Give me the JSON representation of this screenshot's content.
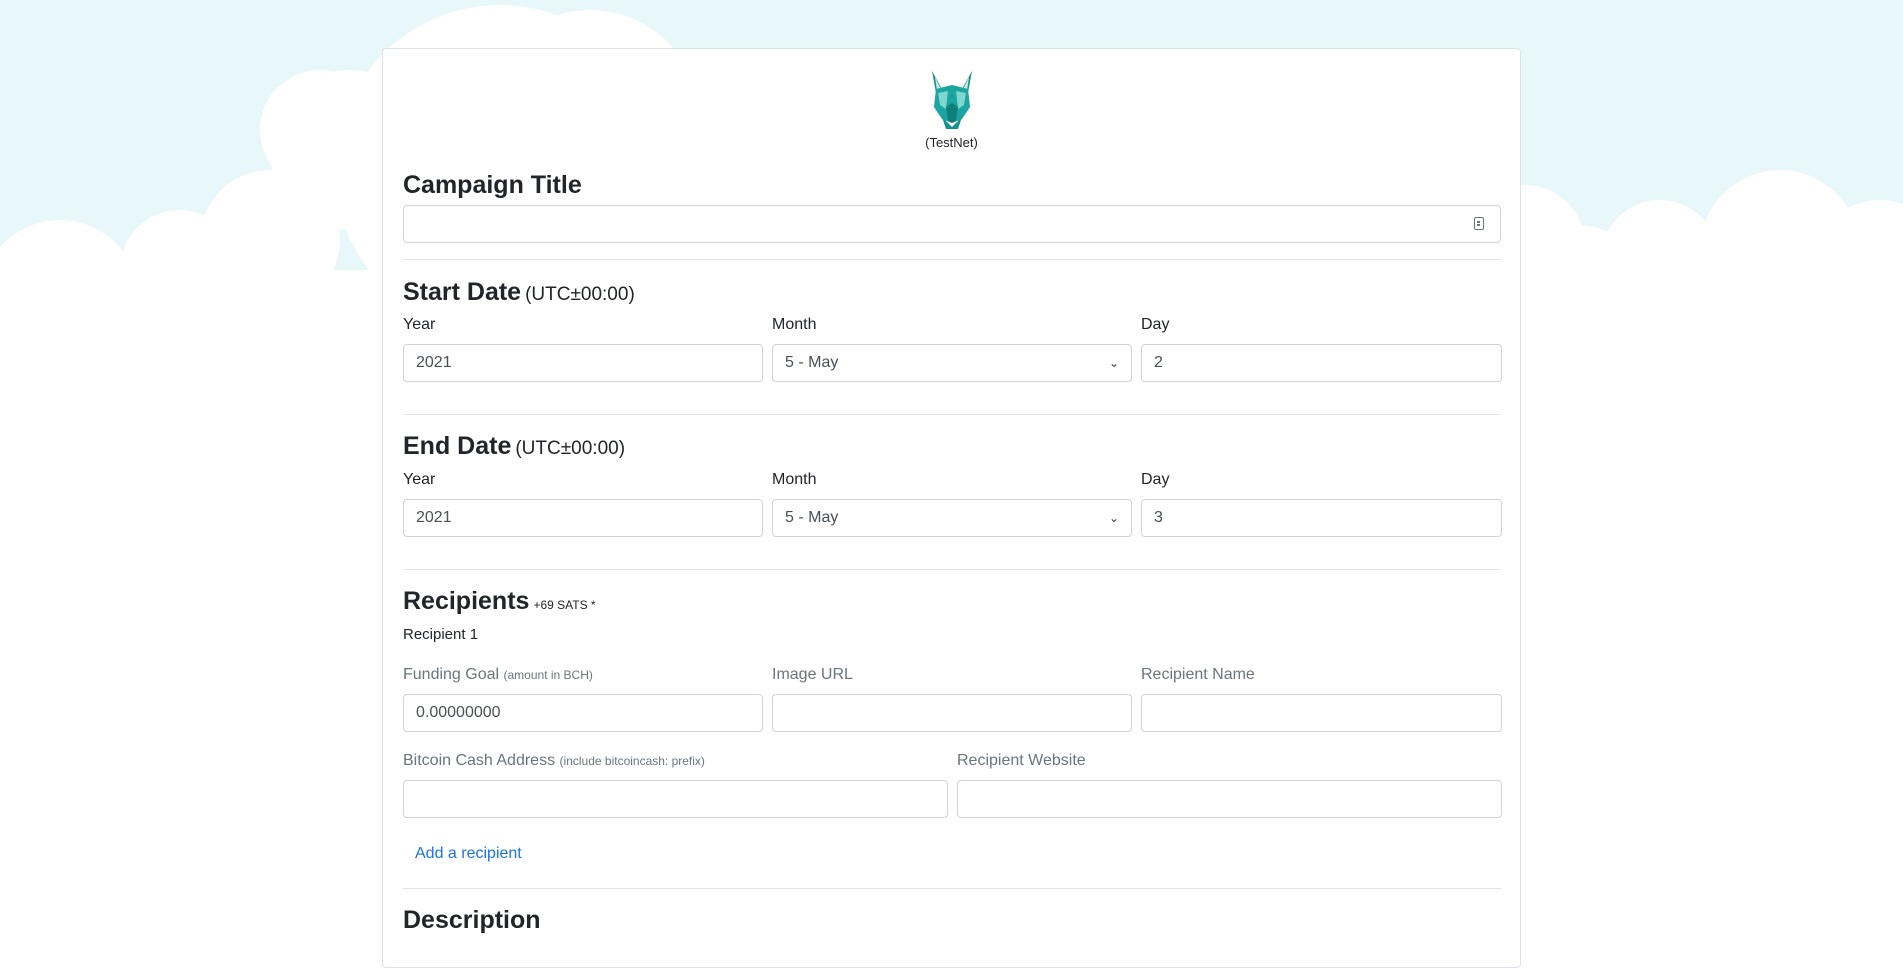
{
  "header": {
    "network_label": "(TestNet)"
  },
  "campaign_title": {
    "heading": "Campaign Title",
    "value": ""
  },
  "start_date": {
    "heading": "Start Date",
    "timezone": "(UTC±00:00)",
    "year_label": "Year",
    "year_value": "2021",
    "month_label": "Month",
    "month_value": "5 - May",
    "day_label": "Day",
    "day_value": "2"
  },
  "end_date": {
    "heading": "End Date",
    "timezone": "(UTC±00:00)",
    "year_label": "Year",
    "year_value": "2021",
    "month_label": "Month",
    "month_value": "5 - May",
    "day_label": "Day",
    "day_value": "3"
  },
  "recipients": {
    "heading": "Recipients",
    "fee_note": "+69 SATS *",
    "recipient_label": "Recipient 1",
    "funding_goal_label": "Funding Goal",
    "funding_goal_hint": "(amount in BCH)",
    "funding_goal_value": "0.00000000",
    "image_url_label": "Image URL",
    "recipient_name_label": "Recipient Name",
    "address_label": "Bitcoin Cash Address",
    "address_hint": "(include bitcoincash: prefix)",
    "website_label": "Recipient Website",
    "add_link": "Add a recipient"
  },
  "description": {
    "heading": "Description"
  },
  "icons": {
    "logo": "wolf-logo-icon",
    "title_field": "text-field-icon",
    "select": "chevron-down-icon"
  },
  "colors": {
    "sky": "#e8f7f9",
    "link": "#1a73e8",
    "logo_teal": "#1aa5a0"
  }
}
